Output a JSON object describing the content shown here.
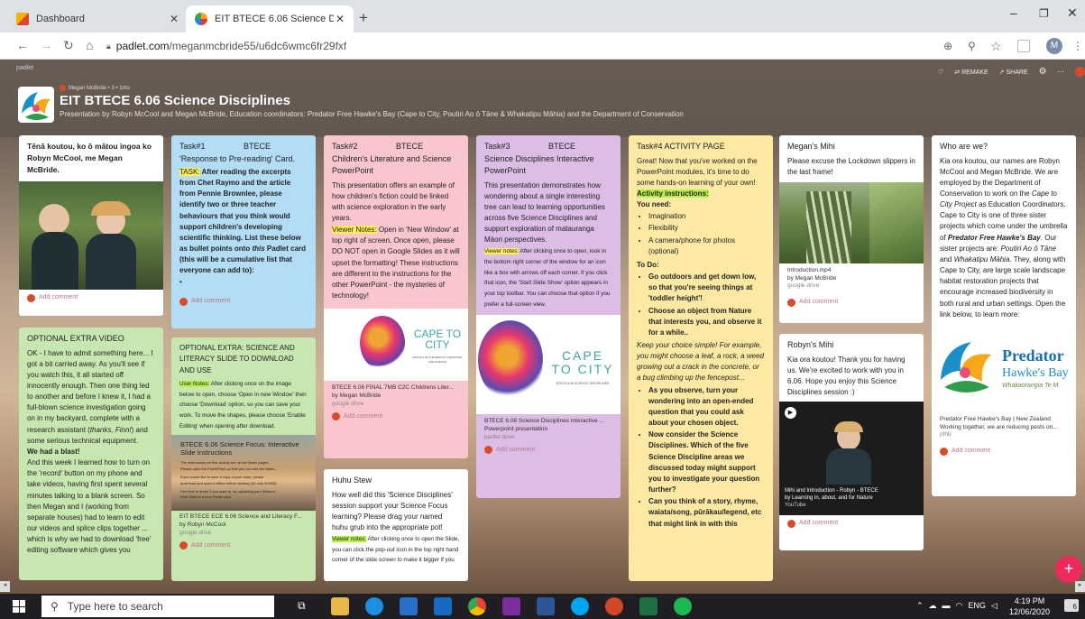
{
  "browser": {
    "tabs": [
      {
        "label": "Dashboard"
      },
      {
        "label": "EIT BTECE 6.06 Science Discipline"
      }
    ],
    "url_domain": "padlet.com",
    "url_path": "/meganmcbride55/u6dc6wmc6fr29fxf",
    "profile_initial": "M"
  },
  "padlet": {
    "brand": "padlet",
    "author": "Megan McBride  •  3  •  1mo",
    "title": "EIT BTECE 6.06 Science Disciplines",
    "subtitle": "Presentation by Robyn McCool and Megan McBride, Education coordinators: Predator Free Hawke's Bay (Cape to City, Poutiri Ao ō Tāne & Whakatipu Māhia) and the Department of Conservation",
    "actions": {
      "remake": "REMAKE",
      "share": "SHARE"
    }
  },
  "add_comment": "Add comment",
  "col1": {
    "intro": "Tēnā koutou,  ko ō mātou ingoa ko Robyn McCool, me Megan McBride.",
    "video_title": "OPTIONAL EXTRA VIDEO",
    "video_text1": "OK - I have to admit something here... I got a bit carried away. As you'll see if you watch this, it all started  off innocently enough. Then one thing led to another and before I knew it, I had a full-blown science investigation going on in my backyard, complete with a research assistant (",
    "video_text_it": "thanks, Finn!",
    "video_text2": ") and some serious technical equipment.",
    "video_blast": "We had a blast!",
    "video_text3": "And this week I learned how to turn on the 'record' button on my phone and take videos, having first spent several minutes talking to a blank screen. So then Megan and I (working from separate houses) had to learn to edit our videos and splice clips together ... which is why we had to download 'free' editing software which gives you"
  },
  "col2": {
    "t1_title": "Task#1                 BTECE",
    "t1_sub": "'Response to Pre-reading' Card.",
    "t1_label": "TASK:",
    "t1_text": " After reading the excerpts from Chet Raymo and the article from Pennie Brownlee, please identify two or three teacher behaviours that you think would support children's developing scientific thinking. List these below as bullet points onto ",
    "t1_it": "this",
    "t1_text2": " Padlet card (this will be a cumulative list that everyone can add to):",
    "t1_bullet": "•",
    "ex_title": "OPTIONAL EXTRA: SCIENCE AND LITERACY SLIDE TO DOWNLOAD AND USE",
    "ex_label": "User Notes:",
    "ex_text": " After clicking once on the image below to open, choose 'Open in new Window' then choose 'Download' option, so you can save your work. To move the shapes, please choose 'Enable Editing' when opening after download.",
    "slide_title": "BTECE 6.06 Science Focus: Interactive Slide Instructions",
    "slide_lines": [
      "The instructions for this activity are on the Notes pages.",
      "Please open the PowerPoint so that you can see the Notes.",
      "If you would like to save a copy of your work, please",
      "download and open it offline before starting (it's only 400KB)",
      "Feel free to share if you want to, by uploading your finished",
      "Kete Slide to a new Padlet card"
    ],
    "ex_file": "EIT BTECE ECE 6.06 Science and Literacy F...",
    "ex_by": "by Robyn McCool",
    "ex_src": "google drive"
  },
  "col3": {
    "t2_title": "Task#2                 BTECE",
    "t2_sub": "Children's Literature and Science PowerPoint",
    "t2_text": "This presentation offers an example of how children's fiction could be linked with science exploration in the early years.",
    "t2_label": "Viewer Notes:",
    "t2_text2": " Open in 'New Window' at top right of screen. Once open, please DO NOT open in Google Slides as it will upset the formatting! These instructions are different to the instructions for the other PowerPoint - the mysteries of technology!",
    "cape_big": "CAPE TO CITY",
    "cape_small": "BTECE 6.06 CHILDREN'S LITERATURE AND SCIENCE",
    "t2_file": "BTECE 6.06 FINAL 7MB C2C Childrens Liter...",
    "t2_by": "by Megan McBride",
    "t2_src": "google drive",
    "huhu_title": "Huhu Stew",
    "huhu_text": "How well did this 'Science Disciplines' session support your Science Focus learning? Please drag your named huhu grub into the appropriate pot!",
    "huhu_label": "Viewer notes:",
    "huhu_text2": " After clicking once to open the Slide, you can click the pop-out icon in the top right hand corner of the slide screen to make it bigger if you"
  },
  "col4": {
    "t3_title": "Task#3                 BTECE",
    "t3_sub": "Science Disciplines Interactive PowerPoint",
    "t3_text": "This presentation demonstrates how wondering about a single interesting tree can lead to learning opportunities across five Science Disciplines and support exploration of matauranga Māori perspectives.",
    "t3_label": "Viewer notes:",
    "t3_text2": " After clicking once to open, look in the bottom right corner of the window for an icon like a box with arrows off each corner. If you click that icon, the 'Start Slide Show' option appears in your top toolbar. You can choose that option if you prefer a full-screen view.",
    "cape_line1": "CAPE",
    "cape_line2": "TO CITY",
    "cape_small": "BTECE 6.06 SCIENCE DISCIPLINES",
    "t3_file": "BTECE 6.06 Science Disciplines Interactive ...",
    "t3_type": "Powerpoint presentation",
    "t3_src": "padlet drive"
  },
  "col5": {
    "title": "Task#4  ACTIVITY PAGE",
    "intro": "Great! Now that you've worked on the PowerPoint modules, it's time to do some hands-on learning of your own!",
    "act_label": "Activity instructions:",
    "need": "You need:",
    "needs": [
      "Imagination",
      "Flexibility",
      "A camera/phone for photos (optional)"
    ],
    "todo": "To Do:",
    "todos": [
      "Go outdoors and get down low, so that you're seeing things at 'toddler height'!",
      "Choose an object from Nature that interests you, and observe it for a while.."
    ],
    "keep": "Keep your choice simple! For example, you might choose a leaf, a rock, a weed growing out a crack in the concrete, or a bug climbing up the fencepost...",
    "todos2": [
      "As you observe, turn your wondering into an open-ended question that you could ask about your chosen object.",
      "Now consider the Science Disciplines. Which of the five Science Discipline areas we discussed today might support you to investigate your question further?",
      "Can you think of a story, rhyme, waiata/song, pūrākau/legend, etc that might link in with this"
    ]
  },
  "col6": {
    "m_title": "Megan's Mihi",
    "m_text": "Please excuse the Lockdown slippers in the last frame!",
    "m_file": "Introduction.mp4",
    "m_by": "by Megan McBride",
    "m_src": "google drive",
    "r_title": "Robyn's Mihi",
    "r_text": "Kia ora koutou! Thank you for having us. We're excited to work with you in 6.06. Hope you enjoy this Science Disciplines session :)",
    "r_file": "Mihi and Introduction - Robyn - BTECE",
    "r_by": "by Learning in, about, and for Nature",
    "r_src": "YouTube"
  },
  "col7": {
    "title": "Who are we?",
    "text1": "Kia ora koutou, our names are Robyn McCool and Megan McBride. We are employed by the Department of Conservation to work on the ",
    "it1": "Cape to City Project",
    "text2": " as Education Coordinators.  Cape to City is one of three sister projects which come under the umbrella of ",
    "bi1": "Predator Free Hawke's Bay",
    "text3": ".      Our sister projects are: ",
    "it2": "Poutiri Ao ō Tāne",
    "text4": " and ",
    "it3": "Whakatipu Māhia",
    "text5": ".  They, along with Cape to City, are large scale landscape habitat restoration projects that encourage increased biodiversity in both rural and urban settings. Open the link below, to learn more:",
    "logo_l1": "Predator",
    "logo_l2": "Hawke's Bay",
    "logo_l3": "Whakaorangia Te M",
    "link_title": "Predator Free Hawke's Bay | New Zealand",
    "link_desc": "Working together, we are reducing pests on...",
    "link_src": "pfhb"
  },
  "taskbar": {
    "search": "Type here to search",
    "lang": "ENG",
    "time": "4:19 PM",
    "date": "12/06/2020",
    "notif": "6"
  },
  "colors": {
    "blue": "#b3dcf5",
    "pink": "#f8c6cc",
    "purple": "#dbbde6",
    "yellow": "#fde9a4",
    "green": "#c8e6b0",
    "white": "#ffffff",
    "accent": "#ee2a5d"
  }
}
